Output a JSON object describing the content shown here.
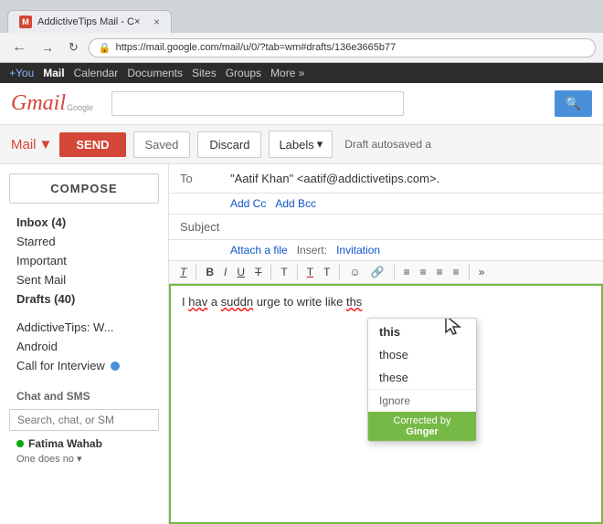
{
  "browser": {
    "tab_favicon": "M",
    "tab_title": "AddictiveTips Mail - C×",
    "tab_close": "×",
    "url": "https://mail.google.com/mail/u/0/?tab=wm#drafts/136e3665b77",
    "back_btn": "←",
    "forward_btn": "→",
    "reload_btn": "↻"
  },
  "google_nav": {
    "plus": "+You",
    "mail": "Mail",
    "calendar": "Calendar",
    "documents": "Documents",
    "sites": "Sites",
    "groups": "Groups",
    "more": "More »"
  },
  "gmail_header": {
    "logo": "Gmail",
    "logo_sub": "Google",
    "search_placeholder": "",
    "search_icon": "🔍"
  },
  "mail_toolbar": {
    "mail_label": "Mail",
    "dropdown_arrow": "▼",
    "send": "SEND",
    "saved": "Saved",
    "discard": "Discard",
    "labels": "Labels",
    "labels_arrow": "▾",
    "draft_status": "Draft autosaved a"
  },
  "sidebar": {
    "compose": "COMPOSE",
    "inbox": "Inbox (4)",
    "starred": "Starred",
    "important": "Important",
    "sent_mail": "Sent Mail",
    "drafts": "Drafts (40)",
    "addictive_tips": "AddictiveTips: W...",
    "android": "Android",
    "call_for_interview": "Call for Interview",
    "chat_section": "Chat and SMS",
    "chat_search_placeholder": "Search, chat, or SM",
    "contact_name": "Fatima Wahab",
    "contact_preview": "One does no",
    "contact_dropdown": "▾"
  },
  "compose": {
    "to_label": "To",
    "to_value": "\"Aatif Khan\" <aatif@addictivetips.com>.",
    "add_cc": "Add Cc",
    "add_bcc": "Add Bcc",
    "subject_label": "Subject",
    "attach_label": "Attach a file",
    "insert_label": "Insert:",
    "insert_value": "Invitation",
    "format_font": "T",
    "format_bold": "B",
    "format_italic": "I",
    "format_underline": "U",
    "format_strikethrough": "T",
    "format_size": "T",
    "format_font2": "T",
    "format_size2": "T",
    "format_emoji": "☺",
    "format_link": "🔗",
    "format_ol": "≡",
    "format_ul": "≡",
    "format_indent_left": "≡",
    "format_indent_right": "≡",
    "format_more": "»",
    "body_text": "I hav a suddn urge to write like ths",
    "misspelled1": "hav",
    "misspelled2": "suddn",
    "misspelled3": "ths"
  },
  "correction_popup": {
    "option1": "this",
    "option2": "those",
    "option3": "these",
    "ignore": "Ignore",
    "footer_corrected": "Corrected by",
    "footer_brand": "Ginger"
  }
}
